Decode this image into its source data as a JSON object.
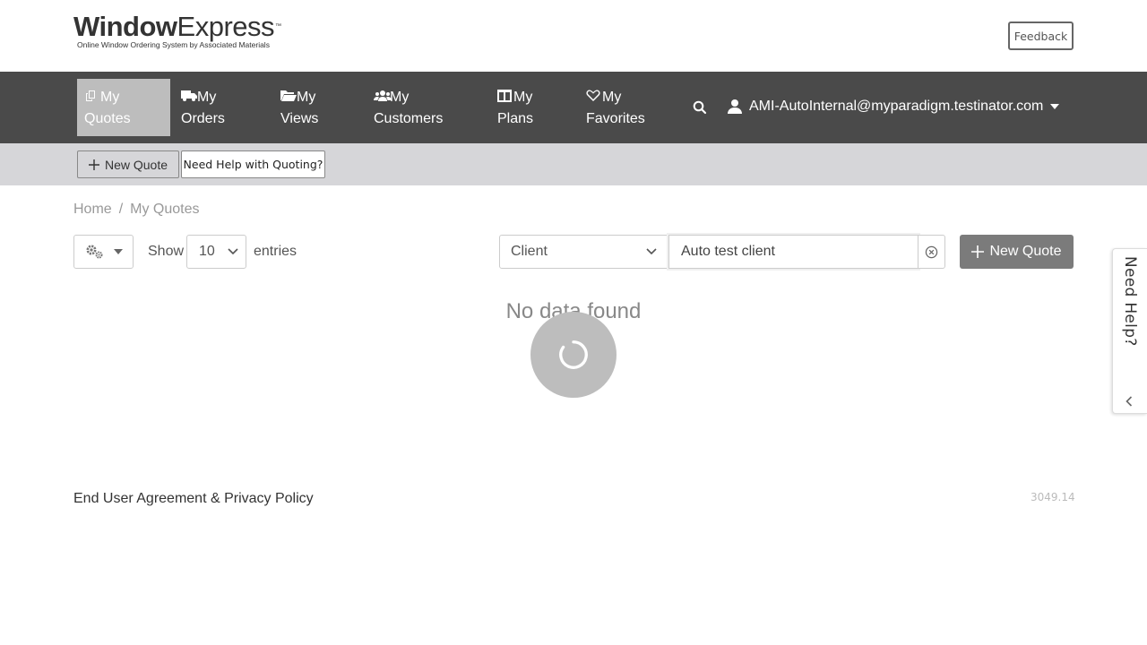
{
  "logo": {
    "brand_bold": "Window",
    "brand_light": "Express",
    "trademark": "™",
    "tagline": "Online Window Ordering System by Associated Materials"
  },
  "header": {
    "feedback_label": "Feedback"
  },
  "navbar": {
    "items": [
      {
        "line1": "My",
        "line2": "Quotes",
        "icon": "copy-icon",
        "active": true
      },
      {
        "line1": "My",
        "line2": "Orders",
        "icon": "truck-icon",
        "active": false
      },
      {
        "line1": "My",
        "line2": "Views",
        "icon": "folder-open-icon",
        "active": false
      },
      {
        "line1": "My",
        "line2": "Customers",
        "icon": "users-icon",
        "active": false
      },
      {
        "line1": "My",
        "line2": "Plans",
        "icon": "columns-icon",
        "active": false
      },
      {
        "line1": "My",
        "line2": "Favorites",
        "icon": "heart-icon",
        "active": false
      }
    ],
    "user_email": "AMI-AutoInternal@myparadigm.testinator.com",
    "background_color": "#4a4a4a",
    "active_color": "#bdbdbd"
  },
  "subbar": {
    "new_quote_label": "New Quote",
    "help_label": "Need Help with Quoting?"
  },
  "breadcrumb": {
    "home": "Home",
    "separator": "/",
    "current": "My Quotes"
  },
  "controls": {
    "show_label": "Show",
    "entries_value": "10",
    "entries_label": "entries",
    "filter_field": "Client",
    "search_value": "Auto test client",
    "new_quote_label": "New Quote"
  },
  "table": {
    "empty_message": "No data found"
  },
  "help_tab": {
    "label": "Need Help?"
  },
  "footer": {
    "agreement_link": "End User Agreement & Privacy Policy",
    "version": "3049.14"
  }
}
